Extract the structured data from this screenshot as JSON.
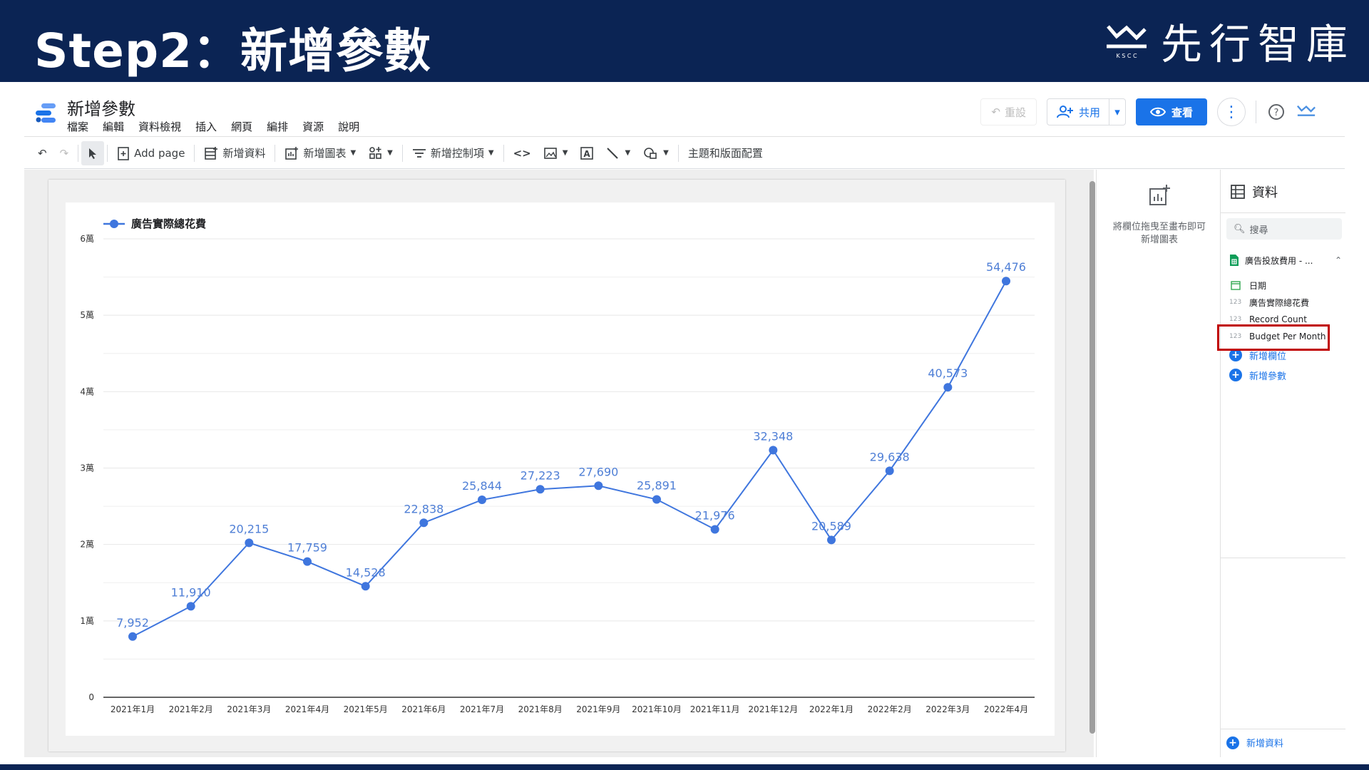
{
  "banner": {
    "title": "Step2：新增參數",
    "brand": "先行智庫",
    "brand_sub": "K S C C"
  },
  "app": {
    "doc_title": "新增參數",
    "menu": [
      "檔案",
      "編輯",
      "資料檢視",
      "插入",
      "網頁",
      "編排",
      "資源",
      "說明"
    ],
    "reset_label": "重設",
    "share_label": "共用",
    "view_label": "查看"
  },
  "toolbar": {
    "add_page": "Add page",
    "add_data": "新增資料",
    "add_chart": "新增圖表",
    "add_control": "新增控制項",
    "theme_layout": "主題和版面配置"
  },
  "add_panel": {
    "hint": "將欄位拖曳至畫布即可新增圖表"
  },
  "data_panel": {
    "title": "資料",
    "search_placeholder": "搜尋",
    "source_name": "廣告投放費用 - ...",
    "fields": [
      {
        "type": "calendar",
        "name": "日期"
      },
      {
        "type": "123",
        "name": "廣告實際總花費"
      },
      {
        "type": "123",
        "name": "Record Count"
      },
      {
        "type": "123",
        "name": "Budget Per Month"
      }
    ],
    "add_field": "新增欄位",
    "add_param": "新增參數",
    "add_data": "新增資料"
  },
  "colors": {
    "banner": "#0b2454",
    "accent": "#1a73e8",
    "line": "#3f76de",
    "highlight": "#c00000"
  },
  "chart_data": {
    "type": "line",
    "legend": "廣告實際總花費",
    "legend_position": "top-left",
    "x": [
      "2021年1月",
      "2021年2月",
      "2021年3月",
      "2021年4月",
      "2021年5月",
      "2021年6月",
      "2021年7月",
      "2021年8月",
      "2021年9月",
      "2021年10月",
      "2021年11月",
      "2021年12月",
      "2022年1月",
      "2022年2月",
      "2022年3月",
      "2022年4月"
    ],
    "series": [
      {
        "name": "廣告實際總花費",
        "values": [
          7952,
          11910,
          20215,
          17759,
          14528,
          22838,
          25844,
          27223,
          27690,
          25891,
          21976,
          32348,
          20589,
          29638,
          40573,
          54476
        ]
      }
    ],
    "value_labels": [
      "7,952",
      "11,910",
      "20,215",
      "17,759",
      "14,528",
      "22,838",
      "25,844",
      "27,223",
      "27,690",
      "25,891",
      "21,976",
      "32,348",
      "20,589",
      "29,638",
      "40,573",
      "54,476"
    ],
    "y_ticks": [
      0,
      10000,
      20000,
      30000,
      40000,
      50000,
      60000
    ],
    "y_tick_labels": [
      "0",
      "1萬",
      "2萬",
      "3萬",
      "4萬",
      "5萬",
      "6萬"
    ],
    "ylim": [
      0,
      60000
    ],
    "grid": true
  }
}
